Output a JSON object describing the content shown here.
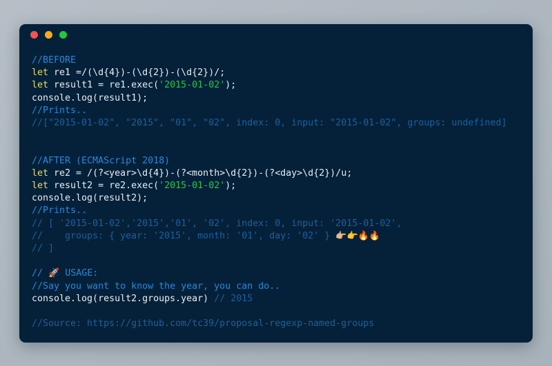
{
  "window": {
    "name": "code-snippet-window",
    "traffic_lights": [
      {
        "name": "close-button",
        "color": "#f9514f"
      },
      {
        "name": "minimize-button",
        "color": "#f9a91a"
      },
      {
        "name": "maximize-button",
        "color": "#25c73f"
      }
    ]
  },
  "theme": {
    "page_background": "#b0b8c0",
    "editor_background": "#052139",
    "comment_bright": "#2e86d8",
    "comment_dim": "#1e5f9e",
    "keyword": "#e6d96a",
    "plain_text": "#e8eef3",
    "string": "#27c93f"
  },
  "code": {
    "language": "javascript",
    "lines": [
      {
        "id": "l1",
        "segments": [
          {
            "style": "cmt",
            "text": "//BEFORE"
          }
        ]
      },
      {
        "id": "l2",
        "segments": [
          {
            "style": "kw",
            "text": "let"
          },
          {
            "style": "plain",
            "text": " re1 =/(\\d{4})-(\\d{2})-(\\d{2})/;"
          }
        ]
      },
      {
        "id": "l3",
        "segments": [
          {
            "style": "kw",
            "text": "let"
          },
          {
            "style": "plain",
            "text": " result1 = re1.exec("
          },
          {
            "style": "str",
            "text": "'2015-01-02'"
          },
          {
            "style": "plain",
            "text": ");"
          }
        ]
      },
      {
        "id": "l4",
        "segments": [
          {
            "style": "plain",
            "text": "console.log(result1);"
          }
        ]
      },
      {
        "id": "l5",
        "segments": [
          {
            "style": "cmt",
            "text": "//Prints.."
          }
        ]
      },
      {
        "id": "l6",
        "segments": [
          {
            "style": "out",
            "text": "//[\"2015-01-02\", \"2015\", \"01\", \"02\", index: 0, input: \"2015-01-02\", groups: undefined]"
          }
        ]
      },
      {
        "id": "l7",
        "blank": true
      },
      {
        "id": "l8",
        "blank": true
      },
      {
        "id": "l9",
        "segments": [
          {
            "style": "cmt",
            "text": "//AFTER (ECMAScript 2018)"
          }
        ]
      },
      {
        "id": "l10",
        "segments": [
          {
            "style": "kw",
            "text": "let"
          },
          {
            "style": "plain",
            "text": " re2 = /(?<year>\\d{4})-(?<month>\\d{2})-(?<day>\\d{2})/u;"
          }
        ]
      },
      {
        "id": "l11",
        "segments": [
          {
            "style": "kw",
            "text": "let"
          },
          {
            "style": "plain",
            "text": " result2 = re2.exec("
          },
          {
            "style": "str",
            "text": "'2015-01-02'"
          },
          {
            "style": "plain",
            "text": ");"
          }
        ]
      },
      {
        "id": "l12",
        "segments": [
          {
            "style": "plain",
            "text": "console.log(result2);"
          }
        ]
      },
      {
        "id": "l13",
        "segments": [
          {
            "style": "cmt",
            "text": "//Prints.."
          }
        ]
      },
      {
        "id": "l14",
        "segments": [
          {
            "style": "out",
            "text": "// [ '2015-01-02','2015','01', '02', index: 0, input: '2015-01-02',"
          }
        ]
      },
      {
        "id": "l15",
        "segments": [
          {
            "style": "out",
            "text": "//    groups: { year: '2015', month: '01', day: '02' } "
          },
          {
            "style": "emoji",
            "text": "👉🏼👉🔥🔥"
          }
        ]
      },
      {
        "id": "l16",
        "segments": [
          {
            "style": "out",
            "text": "// ]"
          }
        ]
      },
      {
        "id": "l17",
        "blank": true
      },
      {
        "id": "l18",
        "segments": [
          {
            "style": "cmt",
            "text": "// "
          },
          {
            "style": "emoji",
            "text": "🚀"
          },
          {
            "style": "cmt",
            "text": " USAGE:"
          }
        ]
      },
      {
        "id": "l19",
        "segments": [
          {
            "style": "cmt",
            "text": "//Say you want to know the year, you can do.."
          }
        ]
      },
      {
        "id": "l20",
        "segments": [
          {
            "style": "plain",
            "text": "console.log(result2.groups.year) "
          },
          {
            "style": "out",
            "text": "// 2015"
          }
        ]
      },
      {
        "id": "l21",
        "blank": true
      },
      {
        "id": "l22",
        "segments": [
          {
            "style": "out",
            "text": "//Source: https://github.com/tc39/proposal-regexp-named-groups"
          }
        ]
      }
    ]
  }
}
